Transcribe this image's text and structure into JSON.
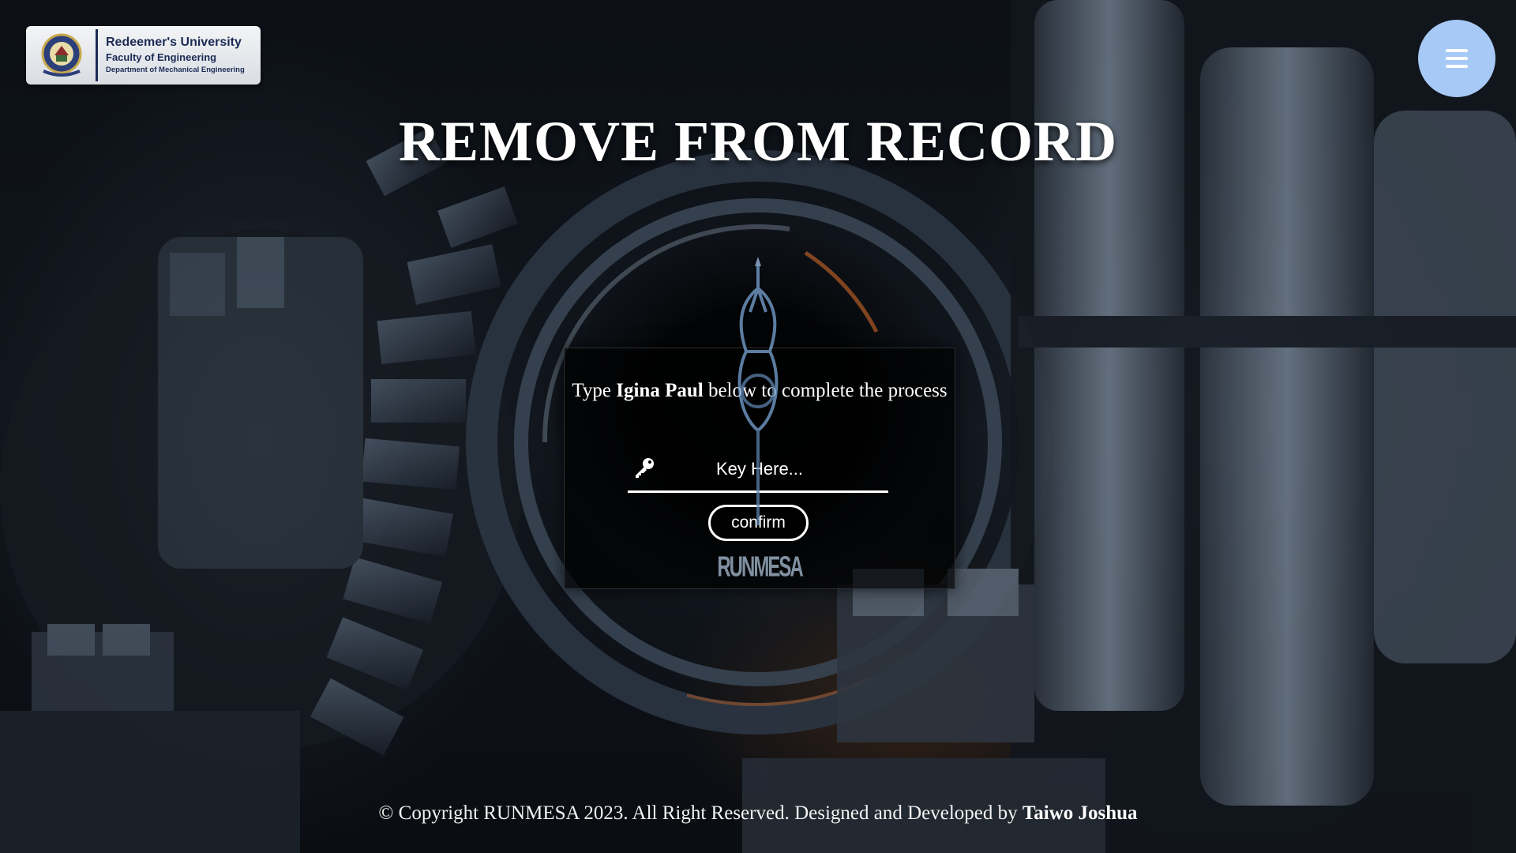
{
  "header": {
    "logo": {
      "university": "Redeemer's University",
      "faculty": "Faculty of Engineering",
      "department": "Department of Mechanical Engineering",
      "brand_color": "#1b2b55"
    },
    "menu_icon": "hamburger-icon",
    "menu_color": "#a6c9f5"
  },
  "page": {
    "title": "REMOVE FROM RECORD"
  },
  "dialog": {
    "prompt_prefix": "Type",
    "target_name": "Igina Paul",
    "prompt_suffix": "below to complete the process",
    "key_icon": "key-icon",
    "key_placeholder": "Key Here...",
    "confirm_label": "confirm",
    "watermark": "RUNMESA"
  },
  "footer": {
    "text": "© Copyright RUNMESA 2023. All Right Reserved. Designed and Developed by",
    "developer": "Taiwo Joshua"
  }
}
